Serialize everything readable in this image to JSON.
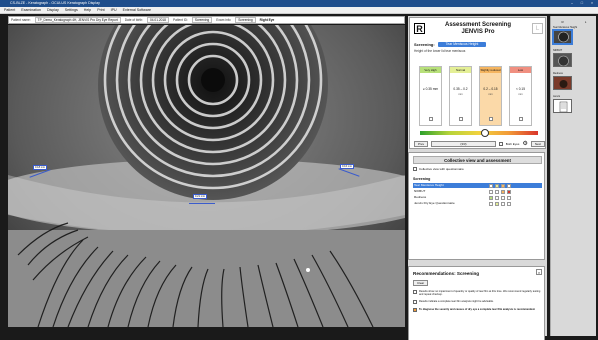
{
  "window": {
    "title": "CS-BLZE - Keratograph - OCULUS Keratograph Display"
  },
  "menu": [
    "Patient",
    "Examination",
    "Display",
    "Settings",
    "Help",
    "Print",
    "IPU",
    "External Software"
  ],
  "infobar": {
    "patient_label": "Patient name:",
    "patient_value": "TP_Demo_Keratograph 4H, JENVIS Pro Dry Eye Report",
    "dob_label": "Date of birth:",
    "dob_value": "04.01.2018",
    "patient_id_label": "Patient ID:",
    "patient_id_value": "Screening",
    "exam_label": "Exam info:",
    "exam_value": "Screening",
    "eye": "Right Eye"
  },
  "measurements": [
    {
      "label": "0.18 mm"
    },
    {
      "label": "0.21 mm"
    },
    {
      "label": "0.16 mm"
    }
  ],
  "assessment": {
    "r_label": "R",
    "l_label": "L",
    "title": "Assessment Screening",
    "subtitle": "JENVIS Pro",
    "screening_label": "Screening:",
    "screening_value": "Tear Meniscus Height",
    "description": "Height of the lower lid tear meniscus",
    "grades": [
      {
        "head": "Very High",
        "value": "≥ 0.35 mm",
        "unit": "",
        "color": "#b7e07a"
      },
      {
        "head": "Normal",
        "value": "0.35 – 0.2",
        "unit": "mm",
        "color": "#e4ef96"
      },
      {
        "head": "Slightly reduced",
        "value": "0.2 – 0.15",
        "unit": "mm",
        "color": "#f5b560"
      },
      {
        "head": "Low",
        "value": "< 0.15",
        "unit": "mm",
        "color": "#f08f80"
      }
    ],
    "gradient_level": 0.55,
    "nav": {
      "prev": "Prev",
      "count": "(3/3)",
      "both_eyes": "Both Eyes",
      "next": "Next"
    }
  },
  "collective": {
    "title": "Collective view and assessment",
    "checkbox_label": "Collective view with questionnaire",
    "section": "Screening",
    "rows": [
      {
        "label": "Tear Meniscus Height",
        "selected": true
      },
      {
        "label": "NIKBUT",
        "selected": false
      },
      {
        "label": "Redness",
        "selected": false
      },
      {
        "label": "Jenvis Dry Eye Questionnaire",
        "selected": false
      }
    ]
  },
  "recommendations": {
    "title": "Recommendations: Screening",
    "close": "×",
    "clear": "Clear",
    "items": [
      "Results show no impairment of quantity or quality of tear film at this time. We recommend regularly testing and repeat checkup.",
      "Results indicate a complete tear film analysis might be advisable.",
      "To diagnose the severity and causes of dry eye a complete tear film analysis is recommended."
    ]
  },
  "thumbnails": {
    "header_r": "R",
    "header_l": "L",
    "items": [
      {
        "label": "Tear Meniscus Height",
        "selected": true
      },
      {
        "label": "NIKBUT",
        "selected": false
      },
      {
        "label": "Redness",
        "selected": false
      },
      {
        "label": "Jenvis",
        "selected": false
      }
    ]
  }
}
